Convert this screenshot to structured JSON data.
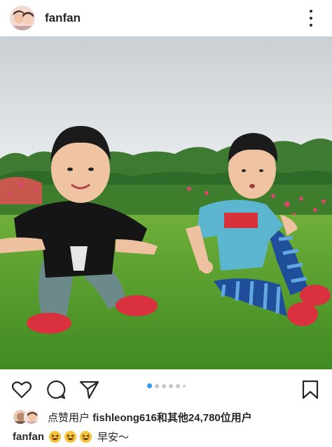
{
  "post": {
    "username": "fanfan",
    "more_icon": "more-vertical-icon"
  },
  "actions": {
    "like_icon": "heart-icon",
    "comment_icon": "comment-icon",
    "share_icon": "send-icon",
    "save_icon": "bookmark-icon"
  },
  "carousel": {
    "total_dots": 6,
    "active_index": 0
  },
  "likes": {
    "prefix": "点赞用户",
    "user": "fishleong616",
    "suffix": "和其他24,780位用户"
  },
  "caption": {
    "username": "fanfan",
    "emoji_count": 3,
    "text": "早安～"
  },
  "colors": {
    "accent": "#3897f0",
    "text": "#262626",
    "inactive_dot": "#c7c7c7",
    "emoji": "#f7c33b"
  }
}
